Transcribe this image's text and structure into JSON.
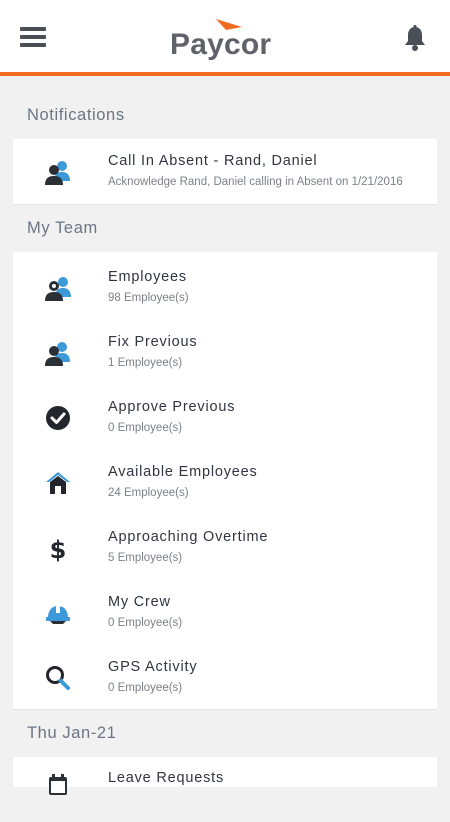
{
  "header": {
    "logo_text": "Paycor",
    "menu_icon": "hamburger-menu-icon",
    "bell_icon": "bell-icon",
    "accent_color": "#f26b21"
  },
  "notifications": {
    "section_title": "Notifications",
    "items": [
      {
        "title": "Call In Absent - Rand, Daniel",
        "subtitle": "Acknowledge Rand, Daniel calling in Absent on 1/21/2016",
        "icon": "people-icon"
      }
    ]
  },
  "my_team": {
    "section_title": "My Team",
    "items": [
      {
        "title": "Employees",
        "subtitle": "98 Employee(s)",
        "icon": "employees-icon"
      },
      {
        "title": "Fix Previous",
        "subtitle": "1 Employee(s)",
        "icon": "people-icon"
      },
      {
        "title": "Approve Previous",
        "subtitle": "0 Employee(s)",
        "icon": "checkmark-circle-icon"
      },
      {
        "title": "Available Employees",
        "subtitle": "24 Employee(s)",
        "icon": "home-icon"
      },
      {
        "title": "Approaching Overtime",
        "subtitle": "5 Employee(s)",
        "icon": "dollar-icon"
      },
      {
        "title": "My Crew",
        "subtitle": "0 Employee(s)",
        "icon": "hard-hat-icon"
      },
      {
        "title": "GPS Activity",
        "subtitle": "0 Employee(s)",
        "icon": "search-icon"
      }
    ]
  },
  "date_section": {
    "section_title": "Thu Jan-21",
    "items": [
      {
        "title": "Leave Requests",
        "icon": "calendar-icon"
      }
    ]
  }
}
